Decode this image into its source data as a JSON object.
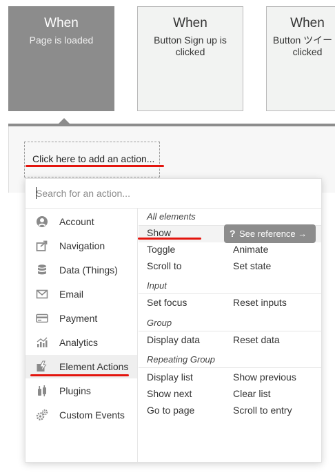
{
  "events": [
    {
      "when": "When",
      "description": "Page is loaded",
      "active": true
    },
    {
      "when": "When",
      "description": "Button Sign up is clicked",
      "active": false
    },
    {
      "when": "When",
      "description": "Button ツイート clicked",
      "active": false
    }
  ],
  "workflow": {
    "add_action_label": "Click here to add an action..."
  },
  "search": {
    "placeholder": "Search for an action..."
  },
  "categories": [
    {
      "label": "Account",
      "icon": "account-icon"
    },
    {
      "label": "Navigation",
      "icon": "navigation-icon"
    },
    {
      "label": "Data (Things)",
      "icon": "database-icon"
    },
    {
      "label": "Email",
      "icon": "email-icon"
    },
    {
      "label": "Payment",
      "icon": "credit-card-icon"
    },
    {
      "label": "Analytics",
      "icon": "analytics-icon"
    },
    {
      "label": "Element Actions",
      "icon": "element-actions-icon",
      "selected": true
    },
    {
      "label": "Plugins",
      "icon": "plugin-icon"
    },
    {
      "label": "Custom Events",
      "icon": "gears-icon"
    }
  ],
  "groups": {
    "all_elements": {
      "title": "All elements",
      "actions": [
        "Show",
        "Animate",
        "Toggle",
        "Scroll to",
        "Set state"
      ]
    },
    "input": {
      "title": "Input",
      "actions": [
        "Set focus",
        "Reset inputs"
      ]
    },
    "group": {
      "title": "Group",
      "actions": [
        "Display data",
        "Reset data"
      ]
    },
    "repeating_group": {
      "title": "Repeating Group",
      "actions": [
        "Display list",
        "Show previous",
        "Show next",
        "Clear list",
        "Go to page",
        "Scroll to entry"
      ]
    }
  },
  "tooltip": {
    "see_reference_label": "See reference →",
    "question_mark": "?"
  },
  "colors": {
    "highlight_underline": "#e3140d",
    "active_card": "#8c8c8c",
    "inactive_card": "#f2f3f2"
  }
}
